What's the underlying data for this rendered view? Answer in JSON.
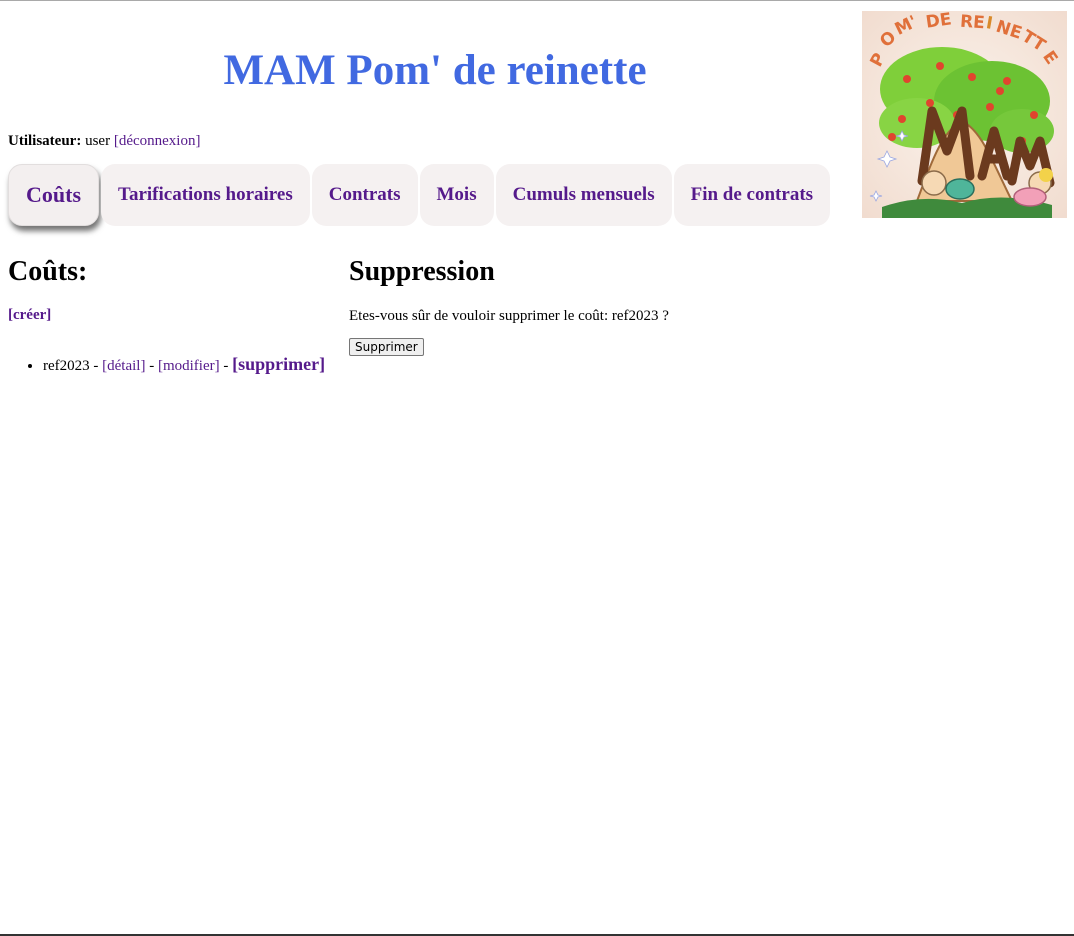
{
  "header": {
    "title": "MAM Pom' de reinette",
    "logo_text": "POM' DE REINETTE MAM"
  },
  "user_bar": {
    "label": "Utilisateur:",
    "username": "user",
    "logout_label": "[déconnexion]"
  },
  "tabs": [
    {
      "label": "Coûts",
      "active": true
    },
    {
      "label": "Tarifications horaires",
      "active": false
    },
    {
      "label": "Contrats",
      "active": false
    },
    {
      "label": "Mois",
      "active": false
    },
    {
      "label": "Cumuls mensuels",
      "active": false
    },
    {
      "label": "Fin de contrats",
      "active": false
    }
  ],
  "costs": {
    "heading": "Coûts:",
    "create_label": "[créer]",
    "items": [
      {
        "name": "ref2023",
        "separator": " - ",
        "detail_label": "[détail]",
        "edit_label": "[modifier]",
        "delete_label": "[supprimer]"
      }
    ]
  },
  "deletion": {
    "heading": "Suppression",
    "confirm_text": "Etes-vous sûr de vouloir supprimer le coût: ref2023 ?",
    "button_label": "Supprimer"
  },
  "colors": {
    "title": "#4169e1",
    "link": "#551a8b",
    "tab_bg": "#f5f1f1"
  }
}
